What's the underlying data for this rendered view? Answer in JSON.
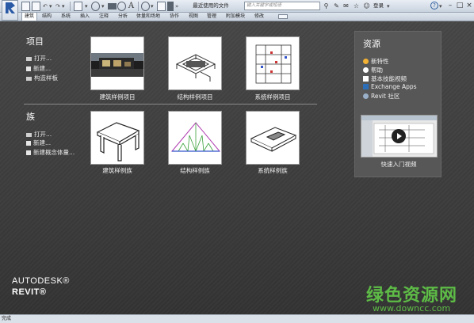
{
  "toolbar": {
    "recent_files_label": "最近使用的文件",
    "search_placeholder": "键入关键字或短语",
    "login_label": "登录"
  },
  "ribbon_tabs": [
    "建筑",
    "结构",
    "系统",
    "插入",
    "注释",
    "分析",
    "体量和场地",
    "协作",
    "视图",
    "管理",
    "附加模块",
    "修改"
  ],
  "projects": {
    "title": "项目",
    "links": [
      "打开...",
      "新建...",
      "构造样板"
    ],
    "thumbnails": [
      "建筑样例项目",
      "结构样例项目",
      "系统样例项目"
    ]
  },
  "families": {
    "title": "族",
    "links": [
      "打开...",
      "新建...",
      "新建概念体量..."
    ],
    "thumbnails": [
      "建筑样例族",
      "结构样例族",
      "系统样例族"
    ]
  },
  "resources": {
    "title": "资源",
    "items": [
      "新特性",
      "帮助",
      "基本技能视频",
      "Exchange Apps",
      "Revit 社区"
    ],
    "video_caption": "快速入门视频"
  },
  "brand": {
    "line1": "AUTODESK®",
    "line2": "REVIT®"
  },
  "watermark": {
    "name": "绿色资源网",
    "url": "www.downcc.com"
  },
  "status_text": "完成",
  "colors": {
    "accent": "#2a5aa6",
    "watermark": "#5dbb46",
    "background": "#3c3c3c"
  }
}
